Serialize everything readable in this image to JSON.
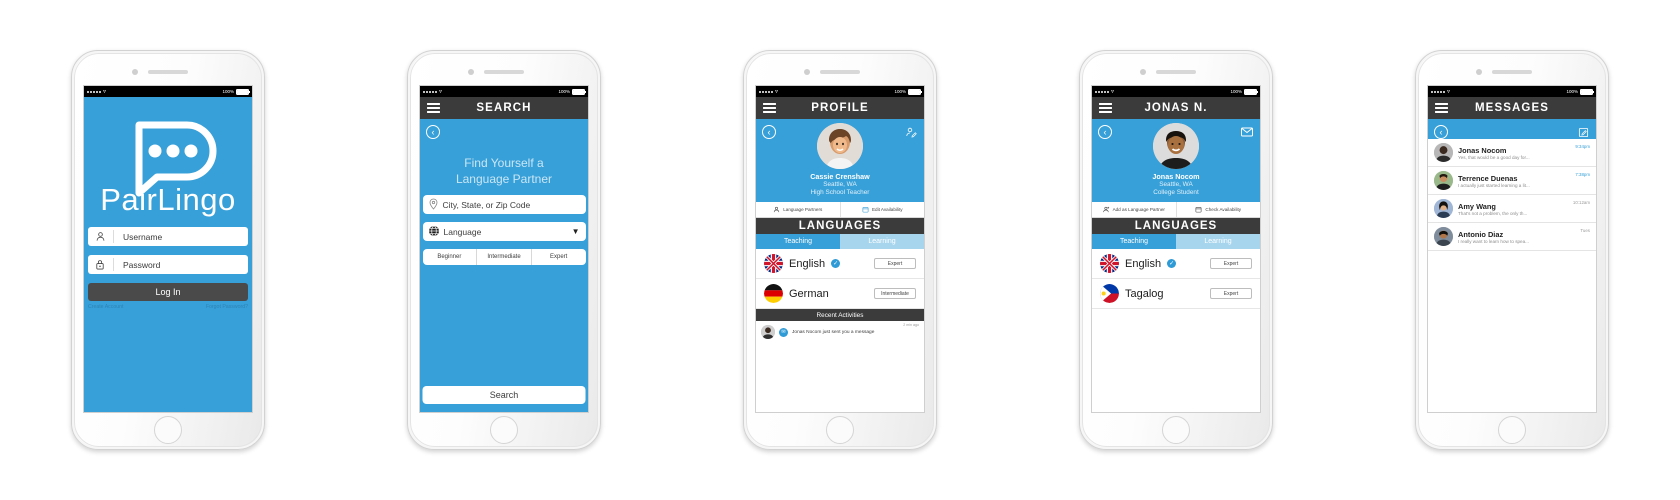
{
  "colors": {
    "brand_blue": "#38a0d8",
    "light_blue": "#a7d5ee",
    "dark_bar": "#3b3b3b",
    "link_blue": "#2a84b6"
  },
  "status_bar": {
    "battery_percent": "100%"
  },
  "screens": {
    "login": {
      "logo_text": "PairLingo",
      "username_placeholder": "Username",
      "password_placeholder": "Password",
      "login_button": "Log In",
      "create_account": "Create Account",
      "forgot_password": "Forgot Password?"
    },
    "search": {
      "title": "SEARCH",
      "tagline_line1": "Find Yourself a",
      "tagline_line2": "Language Partner",
      "location_placeholder": "City, State, or Zip Code",
      "language_placeholder": "Language",
      "levels": [
        "Beginner",
        "Intermediate",
        "Expert"
      ],
      "search_button": "Search"
    },
    "profile": {
      "title": "PROFILE",
      "name": "Cassie Crenshaw",
      "location": "Seattle, WA",
      "occupation": "High School Teacher",
      "actions": [
        {
          "label": "Language Partners",
          "icon": "person-icon"
        },
        {
          "label": "Edit Availability",
          "icon": "calendar-icon"
        }
      ],
      "languages_header": "LANGUAGES",
      "tabs": [
        {
          "label": "Teaching",
          "active": true
        },
        {
          "label": "Learning",
          "active": false
        }
      ],
      "languages": [
        {
          "name": "English",
          "flag": "uk-flag",
          "verified": true,
          "level": "Expert"
        },
        {
          "name": "German",
          "flag": "germany-flag",
          "verified": false,
          "level": "Intermediate"
        }
      ],
      "recent_header": "Recent Activities",
      "activity": {
        "text": "Jonas Nocom just sent you a message",
        "time": "2 min ago"
      }
    },
    "partner": {
      "title": "JONAS N.",
      "name": "Jonas Nocom",
      "location": "Seattle, WA",
      "occupation": "College Student",
      "actions": [
        {
          "label": "Add as Language Partner",
          "icon": "add-person-icon"
        },
        {
          "label": "Check Availability",
          "icon": "calendar-icon"
        }
      ],
      "languages_header": "LANGUAGES",
      "tabs": [
        {
          "label": "Teaching",
          "active": true
        },
        {
          "label": "Learning",
          "active": false
        }
      ],
      "languages": [
        {
          "name": "English",
          "flag": "uk-flag",
          "verified": true,
          "level": "Expert"
        },
        {
          "name": "Tagalog",
          "flag": "philippines-flag",
          "verified": false,
          "level": "Expert"
        }
      ]
    },
    "messages": {
      "title": "MESSAGES",
      "compose_icon": "compose-icon",
      "list": [
        {
          "name": "Jonas Nocom",
          "preview": "Yes, that would be a good day for...",
          "time": "9:34pm",
          "unread": true
        },
        {
          "name": "Terrence Duenas",
          "preview": "I actually just started learning a lit...",
          "time": "7:38pm",
          "unread": true
        },
        {
          "name": "Amy Wang",
          "preview": "That's not a problem, the only th...",
          "time": "10:12am",
          "unread": false
        },
        {
          "name": "Antonio Diaz",
          "preview": "I really want to learn how to spea...",
          "time": "Tues",
          "unread": false
        }
      ]
    }
  }
}
